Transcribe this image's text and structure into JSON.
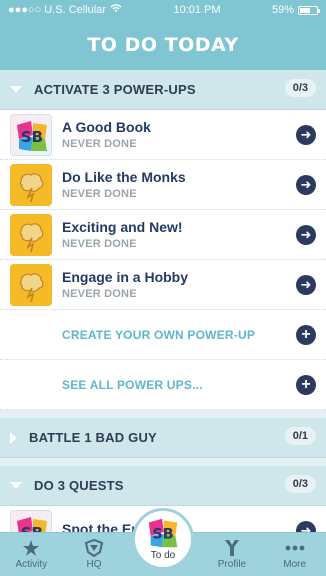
{
  "status": {
    "carrier": "●●●○○ U.S. Cellular",
    "time": "10:01 PM",
    "battery": "59%"
  },
  "header": {
    "title": "TO DO TODAY"
  },
  "sections": [
    {
      "title": "ACTIVATE 3 POWER-UPS",
      "count": "0/3",
      "expanded": true,
      "items": [
        {
          "title": "A Good Book",
          "status": "NEVER DONE",
          "thumb": "superbetter-logo-icon"
        },
        {
          "title": "Do Like the Monks",
          "status": "NEVER DONE",
          "thumb": "brain-lightning-icon"
        },
        {
          "title": "Exciting and New!",
          "status": "NEVER DONE",
          "thumb": "brain-lightning-icon"
        },
        {
          "title": "Engage in a Hobby",
          "status": "NEVER DONE",
          "thumb": "brain-lightning-icon"
        }
      ],
      "links": [
        {
          "text": "CREATE YOUR OWN POWER-UP"
        },
        {
          "text": "SEE ALL POWER UPS..."
        }
      ]
    },
    {
      "title": "BATTLE 1 BAD GUY",
      "count": "0/1",
      "expanded": false
    },
    {
      "title": "DO 3 QUESTS",
      "count": "0/3",
      "expanded": true,
      "items": [
        {
          "title": "Spot the Enemy!",
          "status": "",
          "thumb": "superbetter-logo-icon"
        }
      ]
    }
  ],
  "tabs": [
    {
      "label": "Activity",
      "icon": "activity-icon"
    },
    {
      "label": "HQ",
      "icon": "hq-badge-icon"
    },
    {
      "label": "To do",
      "icon": "superbetter-logo-icon",
      "active": true
    },
    {
      "label": "Profile",
      "icon": "profile-icon"
    },
    {
      "label": "More",
      "icon": "more-dots-icon"
    }
  ],
  "colors": {
    "header": "#7fc5d2",
    "navy": "#2b3a5e",
    "link": "#5fb7c8",
    "badge_bg": "#cfe6ea"
  }
}
